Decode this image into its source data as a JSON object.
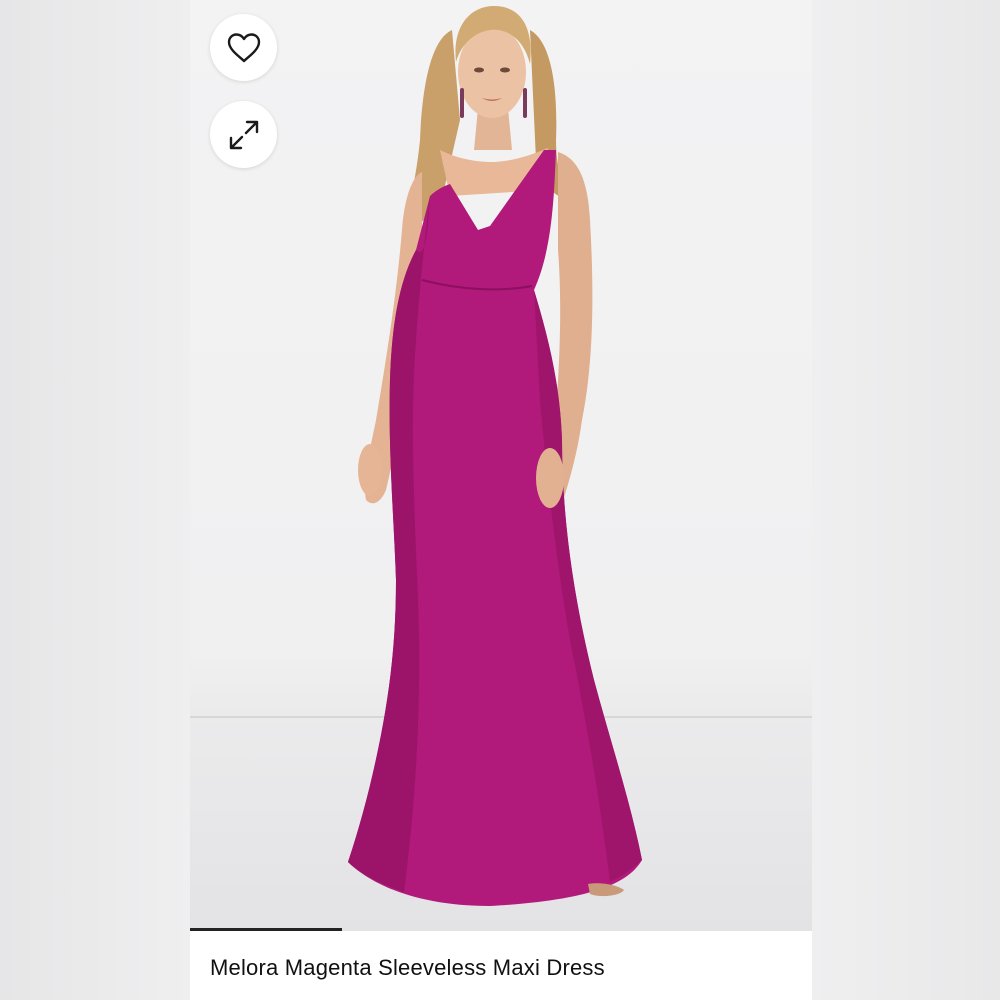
{
  "product": {
    "title": "Melora Magenta Sleeveless Maxi Dress"
  },
  "gallery": {
    "progress_fraction": 0.245,
    "image_alt": "model-wearing-magenta-maxi-dress"
  },
  "actions": {
    "like_icon": "heart-outline-icon",
    "expand_icon": "expand-arrows-icon"
  },
  "colors": {
    "dress": "#b1197a",
    "background": "#f2f2f3"
  }
}
